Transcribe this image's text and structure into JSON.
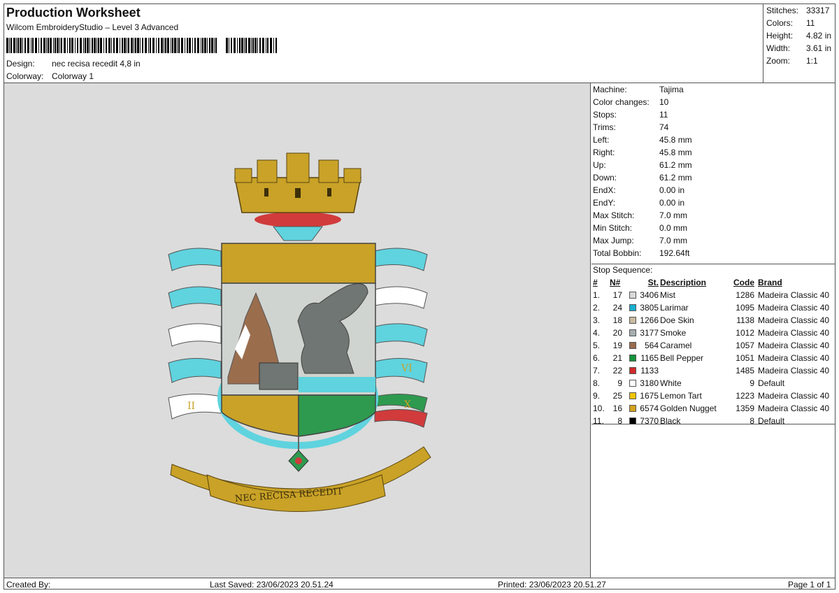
{
  "header": {
    "title": "Production Worksheet",
    "subtitle": "Wilcom EmbroideryStudio – Level 3 Advanced",
    "design_label": "Design:",
    "design_value": "nec recisa recedit 4,8 in",
    "colorway_label": "Colorway:",
    "colorway_value": "Colorway 1"
  },
  "stats": [
    {
      "label": "Stitches:",
      "value": "33317"
    },
    {
      "label": "Colors:",
      "value": "11"
    },
    {
      "label": "Height:",
      "value": "4.82 in"
    },
    {
      "label": "Width:",
      "value": "3.61 in"
    },
    {
      "label": "Zoom:",
      "value": "1:1"
    }
  ],
  "machine": [
    {
      "label": "Machine:",
      "value": "Tajima"
    },
    {
      "label": "Color changes:",
      "value": "10"
    },
    {
      "label": "Stops:",
      "value": "11"
    },
    {
      "label": "Trims:",
      "value": "74"
    },
    {
      "label": "Left:",
      "value": "45.8 mm"
    },
    {
      "label": "Right:",
      "value": "45.8 mm"
    },
    {
      "label": "Up:",
      "value": "61.2 mm"
    },
    {
      "label": "Down:",
      "value": "61.2 mm"
    },
    {
      "label": "EndX:",
      "value": "0.00 in"
    },
    {
      "label": "EndY:",
      "value": "0.00 in"
    },
    {
      "label": "Max Stitch:",
      "value": "7.0 mm"
    },
    {
      "label": "Min Stitch:",
      "value": "0.0 mm"
    },
    {
      "label": "Max Jump:",
      "value": "7.0 mm"
    },
    {
      "label": "Total Bobbin:",
      "value": "192.64ft"
    }
  ],
  "stop_sequence": {
    "title": "Stop Sequence:",
    "headers": {
      "idx": "#",
      "n": "N#",
      "st": "St.",
      "desc": "Description",
      "code": "Code",
      "brand": "Brand"
    },
    "rows": [
      {
        "idx": "1.",
        "n": "17",
        "color": "#d9d9d9",
        "st": "3406",
        "desc": "Mist",
        "code": "1286",
        "brand": "Madeira Classic 40"
      },
      {
        "idx": "2.",
        "n": "24",
        "color": "#1ab0d0",
        "st": "3805",
        "desc": "Larimar",
        "code": "1095",
        "brand": "Madeira Classic 40"
      },
      {
        "idx": "3.",
        "n": "18",
        "color": "#c9bba0",
        "st": "1266",
        "desc": "Doe Skin",
        "code": "1138",
        "brand": "Madeira Classic 40"
      },
      {
        "idx": "4.",
        "n": "20",
        "color": "#a7aeaf",
        "st": "3177",
        "desc": "Smoke",
        "code": "1012",
        "brand": "Madeira Classic 40"
      },
      {
        "idx": "5.",
        "n": "19",
        "color": "#9a6d4d",
        "st": "564",
        "desc": "Caramel",
        "code": "1057",
        "brand": "Madeira Classic 40"
      },
      {
        "idx": "6.",
        "n": "21",
        "color": "#139339",
        "st": "1165",
        "desc": "Bell Pepper",
        "code": "1051",
        "brand": "Madeira Classic 40"
      },
      {
        "idx": "7.",
        "n": "22",
        "color": "#d12b2b",
        "st": "1133",
        "desc": "",
        "code": "1485",
        "brand": "Madeira Classic 40"
      },
      {
        "idx": "8.",
        "n": "9",
        "color": "#ffffff",
        "st": "3180",
        "desc": "White",
        "code": "9",
        "brand": "Default"
      },
      {
        "idx": "9.",
        "n": "25",
        "color": "#f2c500",
        "st": "1675",
        "desc": "Lemon Tart",
        "code": "1223",
        "brand": "Madeira Classic 40"
      },
      {
        "idx": "10.",
        "n": "16",
        "color": "#d3a21d",
        "st": "6574",
        "desc": "Golden Nugget",
        "code": "1359",
        "brand": "Madeira Classic 40"
      },
      {
        "idx": "11.",
        "n": "8",
        "color": "#000000",
        "st": "7370",
        "desc": "Black",
        "code": "8",
        "brand": "Default"
      }
    ]
  },
  "design": {
    "motto": "NEC RECISA RECEDIT",
    "numeral_vi": "VI",
    "numeral_x": "X",
    "numeral_ii": "II",
    "colors": {
      "gold": "#c9a227",
      "cyan": "#5fd3de",
      "green": "#2e9a4f",
      "red": "#d13b3b",
      "slate": "#6f7673"
    }
  },
  "footer": {
    "created_by": "Created By:",
    "last_saved": "Last Saved: 23/06/2023 20.51.24",
    "printed": "Printed: 23/06/2023 20.51.27",
    "page": "Page 1 of 1"
  }
}
